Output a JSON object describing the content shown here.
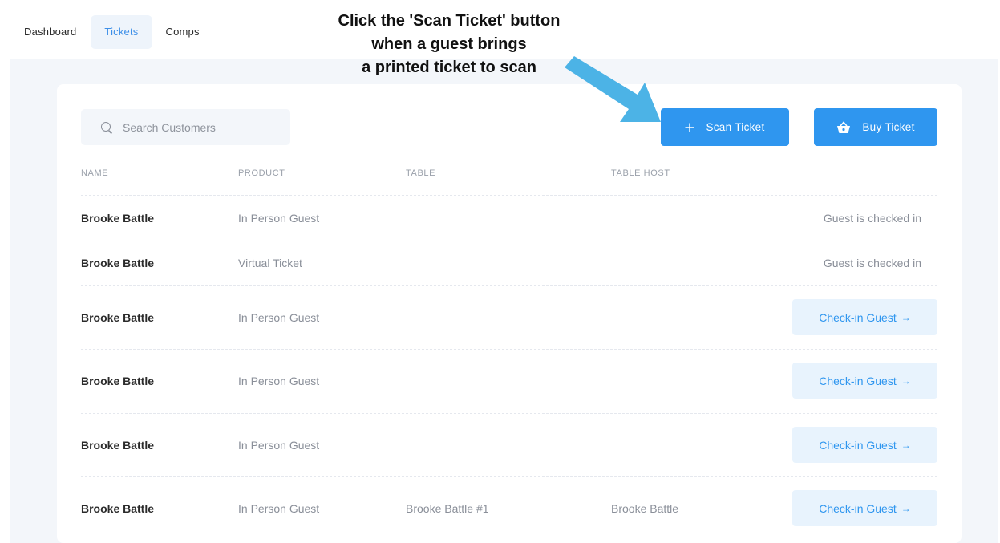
{
  "nav": {
    "tabs": [
      {
        "label": "Dashboard",
        "active": false
      },
      {
        "label": "Tickets",
        "active": true
      },
      {
        "label": "Comps",
        "active": false
      }
    ]
  },
  "annotation": {
    "lines": [
      "Click the 'Scan Ticket' button",
      "when a guest brings",
      "a printed ticket to scan"
    ]
  },
  "search": {
    "placeholder": "Search Customers",
    "value": ""
  },
  "buttons": {
    "scan": "Scan Ticket",
    "buy": "Buy Ticket"
  },
  "table": {
    "headers": [
      "NAME",
      "PRODUCT",
      "TABLE",
      "TABLE HOST"
    ],
    "rows": [
      {
        "name": "Brooke Battle",
        "product": "In Person Guest",
        "table": "",
        "host": "",
        "status": "Guest is checked in",
        "action": ""
      },
      {
        "name": "Brooke Battle",
        "product": "Virtual Ticket",
        "table": "",
        "host": "",
        "status": "Guest is checked in",
        "action": ""
      },
      {
        "name": "Brooke Battle",
        "product": "In Person Guest",
        "table": "",
        "host": "",
        "status": "",
        "action": "Check-in Guest"
      },
      {
        "name": "Brooke Battle",
        "product": "In Person Guest",
        "table": "",
        "host": "",
        "status": "",
        "action": "Check-in Guest"
      },
      {
        "name": "Brooke Battle",
        "product": "In Person Guest",
        "table": "",
        "host": "",
        "status": "",
        "action": "Check-in Guest"
      },
      {
        "name": "Brooke Battle",
        "product": "In Person Guest",
        "table": "Brooke Battle #1",
        "host": "Brooke Battle",
        "status": "",
        "action": "Check-in Guest"
      }
    ]
  },
  "icons": {
    "search": "search-icon",
    "plus": "plus-icon",
    "basket": "basket-icon",
    "arrow": "arrow-right-icon"
  },
  "colors": {
    "accent": "#2f96ef",
    "annotation_arrow": "#4cb3e6",
    "panel_bg": "#f3f6fa"
  }
}
